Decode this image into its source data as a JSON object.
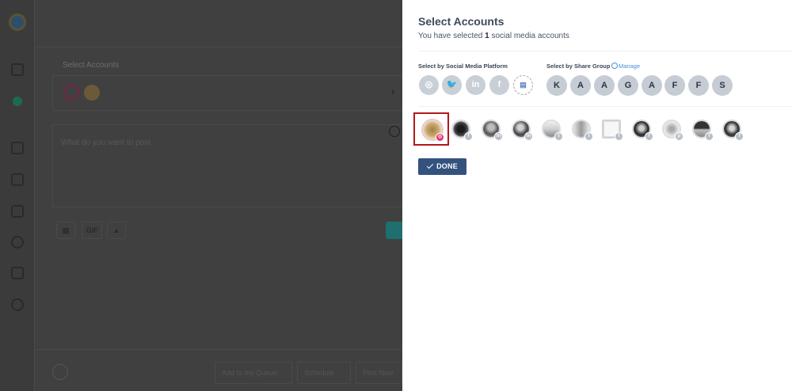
{
  "background": {
    "label_select_accounts": "Select Accounts",
    "compose_placeholder": "What do you want to post",
    "gif_label": "GIF",
    "footer_buttons": [
      "Add to my Queue",
      "Schedule",
      "Post Now"
    ]
  },
  "modal": {
    "title": "Select Accounts",
    "subtitle_prefix": "You have selected",
    "selected_count": "1",
    "subtitle_suffix": "social media accounts",
    "platform_label": "Select by Social Media Platform",
    "group_label": "Select by Share Group",
    "manage_label": "Manage",
    "platforms": [
      {
        "name": "instagram",
        "glyph": "◎"
      },
      {
        "name": "twitter",
        "glyph": "🐦"
      },
      {
        "name": "linkedin",
        "glyph": "in"
      },
      {
        "name": "facebook",
        "glyph": "f"
      },
      {
        "name": "google-business",
        "glyph": "▤"
      }
    ],
    "groups": [
      "K",
      "A",
      "A",
      "G",
      "A",
      "F",
      "F",
      "S"
    ],
    "accounts": [
      {
        "network": "instagram",
        "badge": "◎",
        "selected": true
      },
      {
        "network": "facebook",
        "badge": "f",
        "selected": false
      },
      {
        "network": "linkedin",
        "badge": "in",
        "selected": false
      },
      {
        "network": "linkedin",
        "badge": "in",
        "selected": false
      },
      {
        "network": "twitter",
        "badge": "t",
        "selected": false
      },
      {
        "network": "twitter",
        "badge": "t",
        "selected": false
      },
      {
        "network": "twitter",
        "badge": "t",
        "selected": false
      },
      {
        "network": "facebook",
        "badge": "f",
        "selected": false
      },
      {
        "network": "pinterest",
        "badge": "p",
        "selected": false
      },
      {
        "network": "facebook",
        "badge": "f",
        "selected": false
      },
      {
        "network": "facebook",
        "badge": "f",
        "selected": false
      }
    ],
    "done_label": "DONE"
  },
  "colors": {
    "done_button": "#34527e",
    "selected_frame": "#b3171c",
    "instagram_badge": "#e2336f",
    "link": "#4a8fd8"
  }
}
